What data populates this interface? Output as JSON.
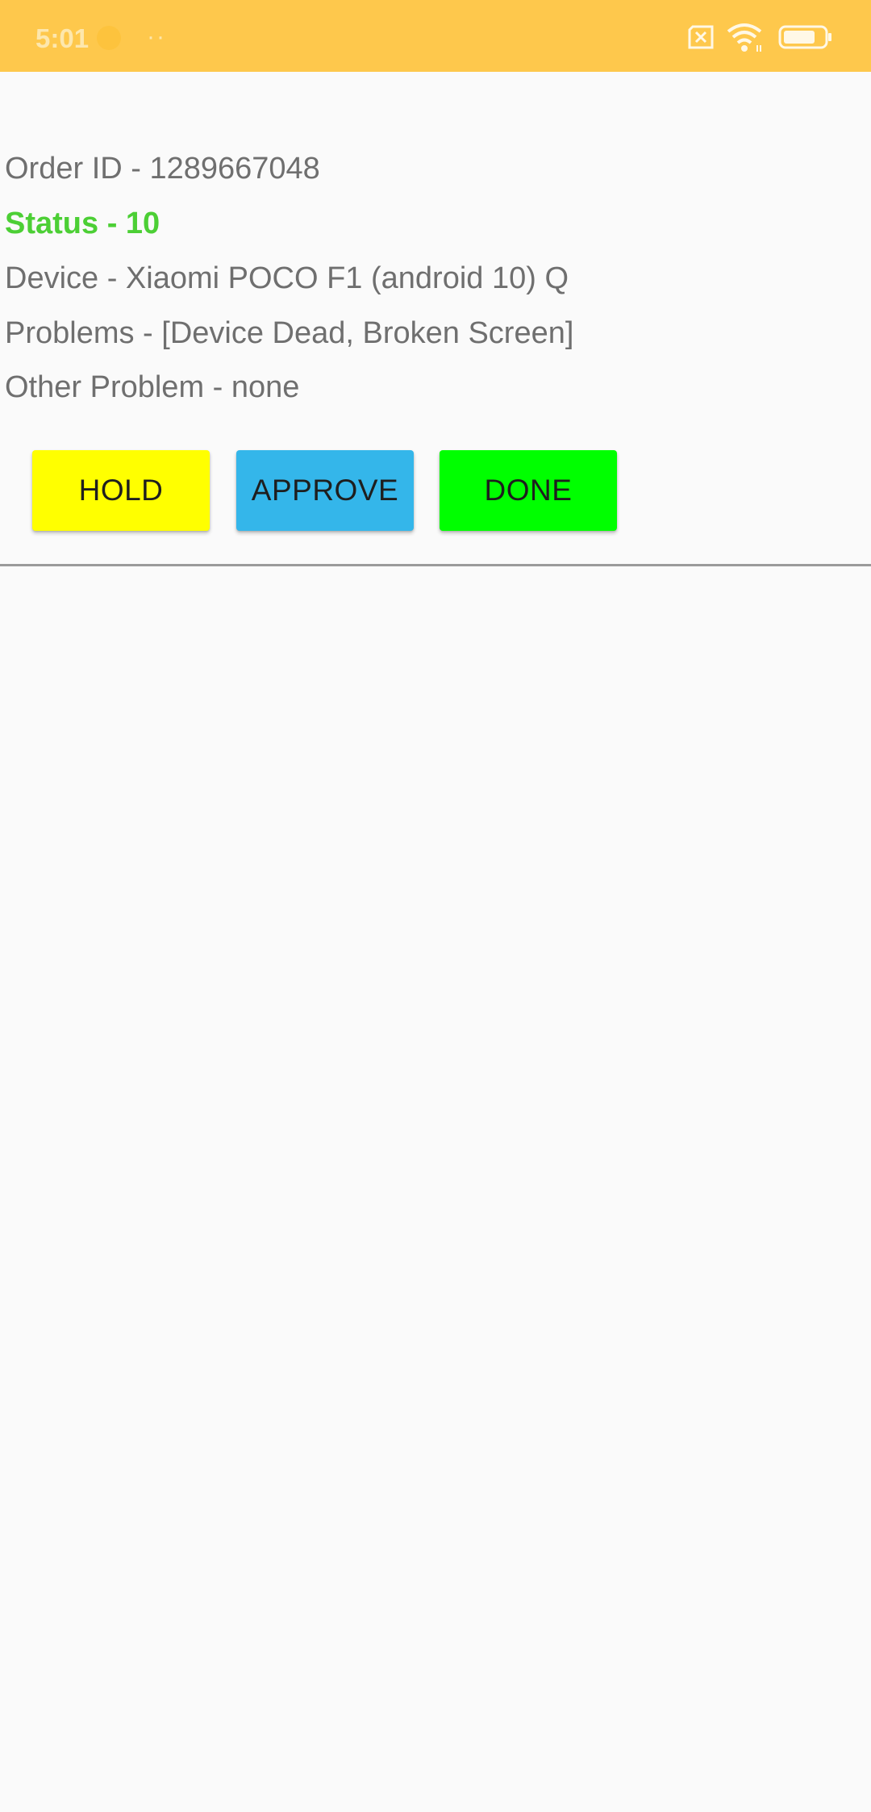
{
  "status_bar": {
    "time": "5:01",
    "dots": "··",
    "background": "#fec84c",
    "icons": [
      "sim-x-icon",
      "wifi-icon",
      "battery-icon"
    ]
  },
  "order": {
    "order_id_line": "Order ID - 1289667048",
    "status_line": "Status - 10",
    "device_line": "Device - Xiaomi POCO F1 (android 10) Q",
    "problems_line": "Problems - [Device Dead, Broken Screen]",
    "other_problem_line": "Other Problem - none",
    "status_color": "#4ccf35"
  },
  "actions": {
    "hold_label": "HOLD",
    "hold_color": "#ffff00",
    "approve_label": "APPROVE",
    "approve_color": "#34b6ea",
    "done_label": "DONE",
    "done_color": "#00ff00"
  }
}
